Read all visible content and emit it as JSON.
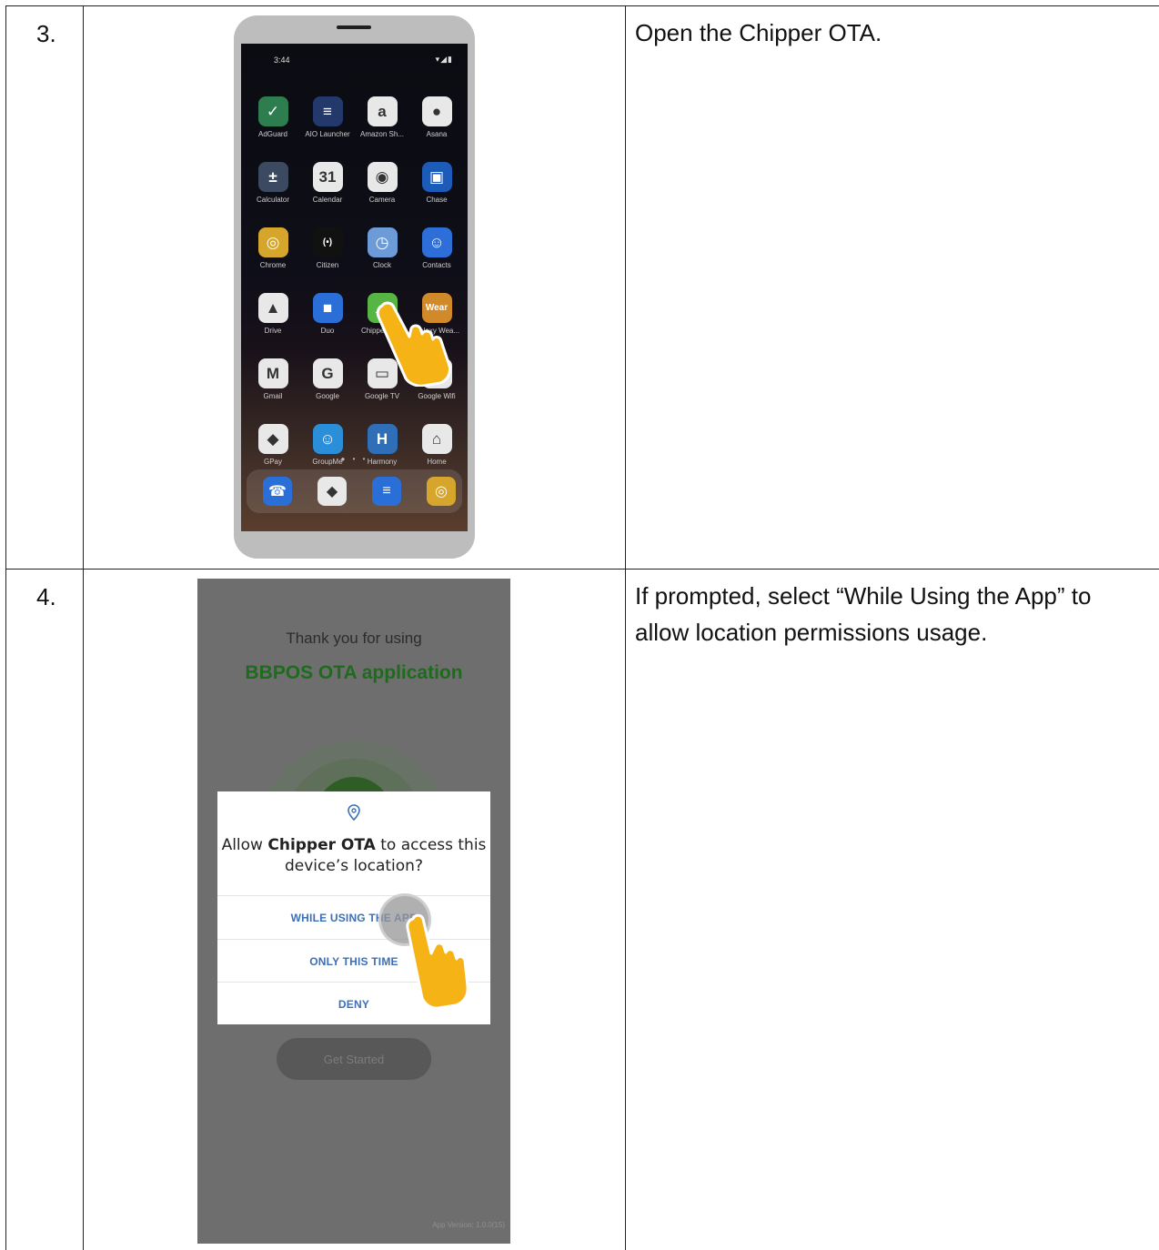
{
  "rows": [
    {
      "step": "3.",
      "instruction": "Open the Chipper OTA."
    },
    {
      "step": "4.",
      "instruction": "If prompted, select “While Using the App” to allow location permissions usage."
    }
  ],
  "phone": {
    "time": "3:44",
    "status_icons": "▾◢▮",
    "apps": [
      {
        "label": "AdGuard",
        "glyph": "✓",
        "color": "#2e7d4f"
      },
      {
        "label": "AIO Launcher",
        "glyph": "≡",
        "color": "#24396b"
      },
      {
        "label": "Amazon Sh...",
        "glyph": "a",
        "color": "#e8e8e8"
      },
      {
        "label": "Asana",
        "glyph": "●",
        "color": "#e8e8e8"
      },
      {
        "label": "Calculator",
        "glyph": "±",
        "color": "#3b4a60"
      },
      {
        "label": "Calendar",
        "glyph": "31",
        "color": "#e8e8e8"
      },
      {
        "label": "Camera",
        "glyph": "◉",
        "color": "#e8e8e8"
      },
      {
        "label": "Chase",
        "glyph": "▣",
        "color": "#1d5bb8"
      },
      {
        "label": "Chrome",
        "glyph": "◎",
        "color": "#d6a52b"
      },
      {
        "label": "Citizen",
        "glyph": "(•)",
        "color": "#111111"
      },
      {
        "label": "Clock",
        "glyph": "◷",
        "color": "#6c9bd8"
      },
      {
        "label": "Contacts",
        "glyph": "☺",
        "color": "#2d6ed8"
      },
      {
        "label": "Drive",
        "glyph": "▲",
        "color": "#e8e8e8"
      },
      {
        "label": "Duo",
        "glyph": "■",
        "color": "#2a6fd8"
      },
      {
        "label": "Chipper OTA",
        "glyph": "☁",
        "color": "#57b643"
      },
      {
        "label": "Galaxy Wea...",
        "glyph": "Wear",
        "color": "#d08a2a"
      },
      {
        "label": "Gmail",
        "glyph": "M",
        "color": "#e8e8e8"
      },
      {
        "label": "Google",
        "glyph": "G",
        "color": "#e8e8e8"
      },
      {
        "label": "Google TV",
        "glyph": "▭",
        "color": "#e8e8e8"
      },
      {
        "label": "Google Wifi",
        "glyph": "○",
        "color": "#e8e8e8"
      },
      {
        "label": "GPay",
        "glyph": "◆",
        "color": "#e8e8e8"
      },
      {
        "label": "GroupMe",
        "glyph": "☺",
        "color": "#2a8fd8"
      },
      {
        "label": "Harmony",
        "glyph": "H",
        "color": "#2e6fb8"
      },
      {
        "label": "Home",
        "glyph": "⌂",
        "color": "#e8e8e8"
      }
    ],
    "dock": [
      {
        "glyph": "☎",
        "color": "#2a6fd8"
      },
      {
        "glyph": "◆",
        "color": "#e8e8e8"
      },
      {
        "glyph": "≡",
        "color": "#2a6fd8"
      },
      {
        "glyph": "◎",
        "color": "#d6a52b"
      }
    ]
  },
  "app_screen": {
    "thanks": "Thank you for using",
    "app_name": "BBPOS OTA application",
    "dialog": {
      "icon": "location-pin-icon",
      "msg_prefix": "Allow ",
      "msg_app": "Chipper OTA",
      "msg_suffix": " to access this device’s location?",
      "options": [
        "WHILE USING THE APP",
        "ONLY THIS TIME",
        "DENY"
      ]
    },
    "get_started": "Get Started",
    "version": "App Version: 1.0.0(15)"
  },
  "colors": {
    "hand": "#f5b316",
    "link_blue": "#3d6fb5",
    "brand_green": "#1f6b1d"
  }
}
